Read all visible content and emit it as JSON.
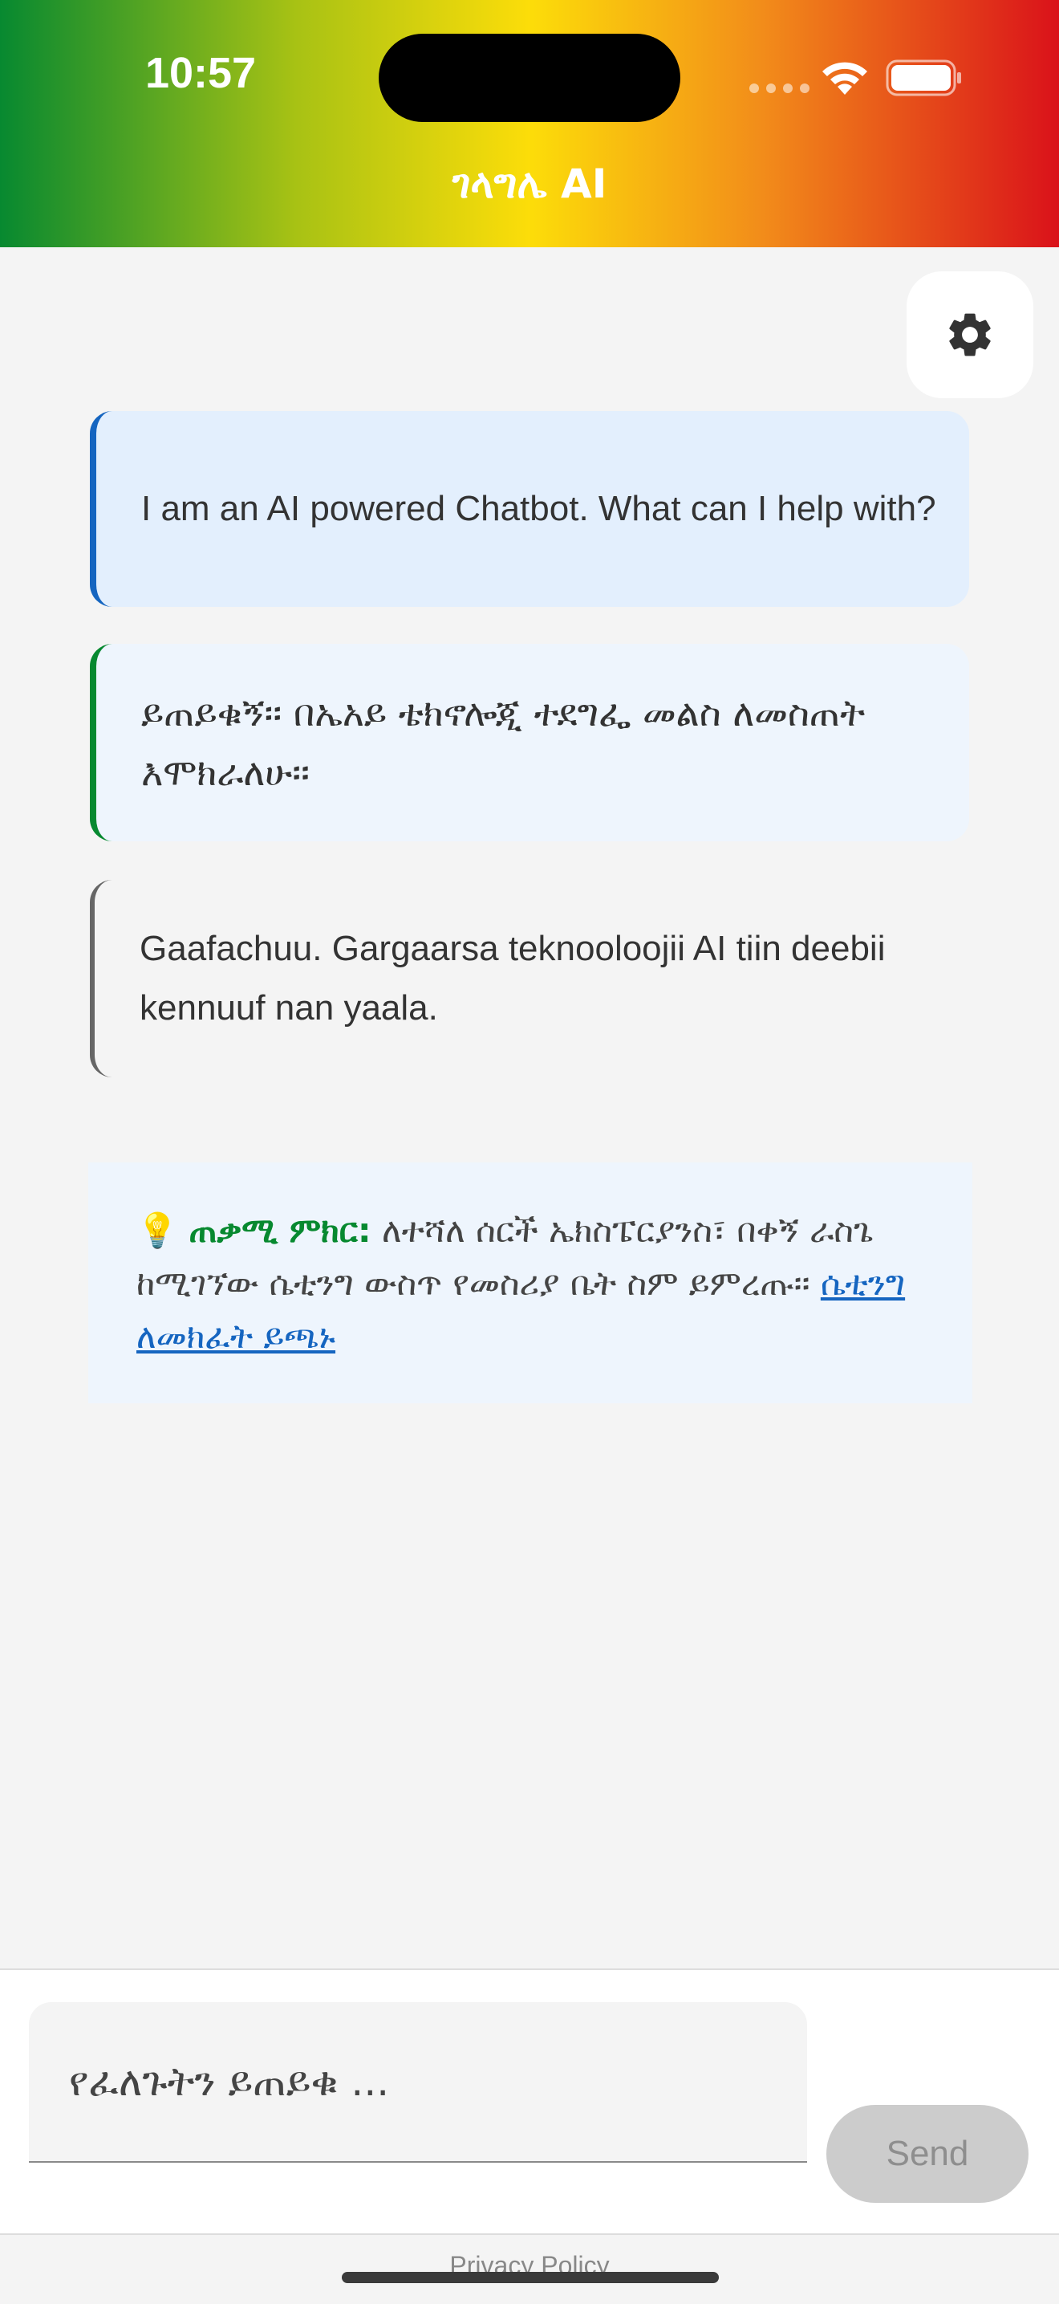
{
  "status_bar": {
    "time": "10:57",
    "icons": [
      "cellular-signal-icon",
      "wifi-icon",
      "battery-icon"
    ]
  },
  "header": {
    "title": "ገላግሌ AI",
    "gradient_colors": [
      "#078930",
      "#fcdd09",
      "#da121a"
    ]
  },
  "settings": {
    "icon": "gear-icon"
  },
  "messages": [
    {
      "text": "I am an AI powered Chatbot. What can I help with?",
      "accent": "#1565c0"
    },
    {
      "text": "ይጠይቁኝ፡፡ በኤአይ ቴክኖሎጂ ተደግፌ መልስ ለመስጠት እሞክራለሁ፡፡",
      "accent": "#078930"
    },
    {
      "text": "Gaafachuu. Gargaarsa teknooloojii AI tiin deebii kennuuf nan yaala.",
      "accent": "#666666"
    }
  ],
  "tip": {
    "icon": "lightbulb-icon",
    "emoji": "💡",
    "label": "ጠቃሚ ምክር:",
    "text": " ለተሻለ ሰርች ኤክስፔርያንስ፣ በቀኝ ራስጌ ከሚገኘው ሴቲንግ ውስጥ የመስሪያ ቤት ስም ይምረጡ፡፡ ",
    "link": "ሴቲንግ ለመክፈት ይጫኑ"
  },
  "input": {
    "placeholder": "የፈለጉትን ይጠይቁ ...",
    "value": "",
    "send_label": "Send"
  },
  "footer": {
    "privacy_label": "Privacy Policy"
  }
}
